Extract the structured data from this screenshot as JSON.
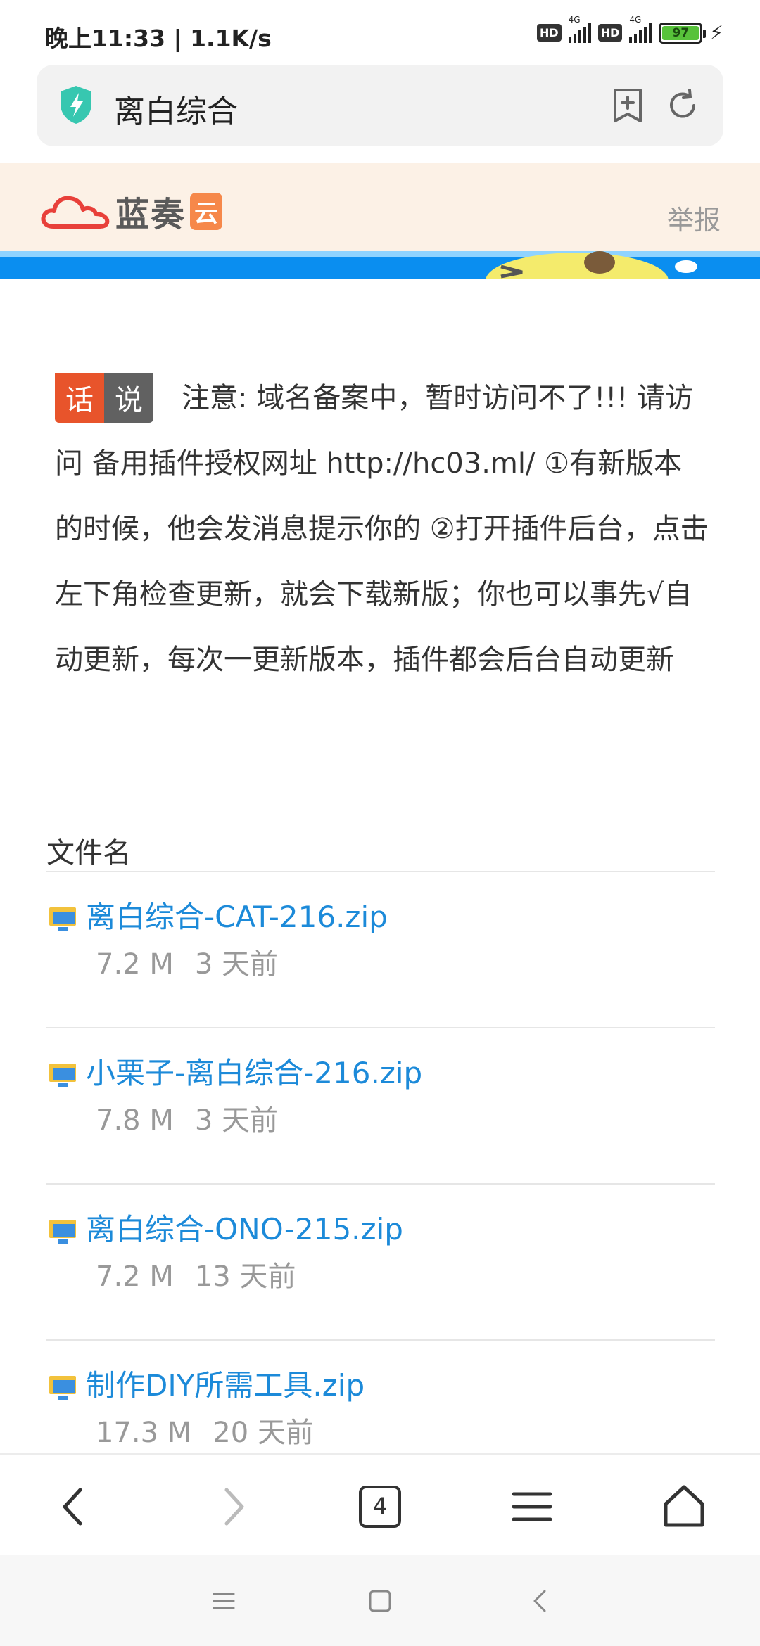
{
  "status": {
    "time": "晚上11:33 | 1.1K/s",
    "hd": "HD",
    "net": "4G",
    "battery": "97"
  },
  "browser": {
    "title": "离白综合",
    "tab_count": "4"
  },
  "site": {
    "logo_text": "蓝奏",
    "logo_yun": "云",
    "report": "举报"
  },
  "notice": {
    "tag1": "话",
    "tag2": "说",
    "text": "注意: 域名备案中，暂时访问不了!!! 请访问 备用插件授权网址 http://hc03.ml/ ①有新版本的时候，他会发消息提示你的 ②打开插件后台，点击左下角检查更新，就会下载新版；你也可以事先√自动更新，每次一更新版本，插件都会后台自动更新"
  },
  "list": {
    "header": "文件名",
    "files": [
      {
        "name": "离白综合-CAT-216.zip",
        "size": "7.2 M",
        "time": "3 天前"
      },
      {
        "name": "小栗子-离白综合-216.zip",
        "size": "7.8 M",
        "time": "3 天前"
      },
      {
        "name": "离白综合-ONO-215.zip",
        "size": "7.2 M",
        "time": "13 天前"
      },
      {
        "name": "制作DIY所需工具.zip",
        "size": "17.3 M",
        "time": "20 天前"
      }
    ]
  },
  "colors": {
    "link": "#1c8ad9",
    "tag_red": "#e8542b",
    "banner_blue": "#0a8ef0",
    "header_bg": "#fcf1e6"
  }
}
